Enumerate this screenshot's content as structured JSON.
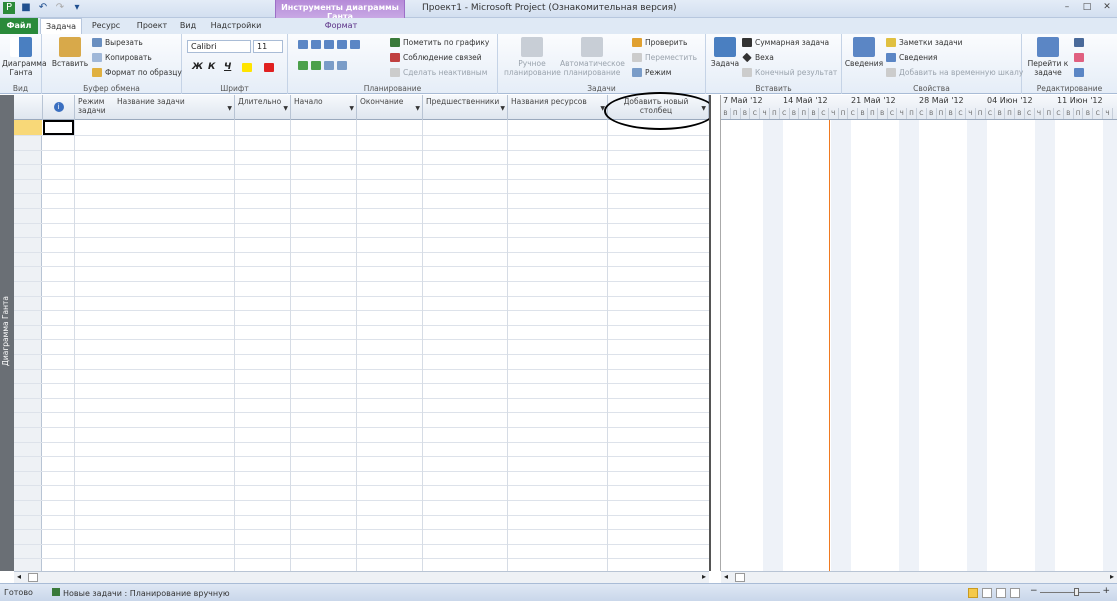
{
  "title": {
    "window": "Проект1 - Microsoft Project (Ознакомительная версия)",
    "context_group": "Инструменты диаграммы Ганта"
  },
  "tabs": [
    "Файл",
    "Задача",
    "Ресурс",
    "Проект",
    "Вид",
    "Надстройки",
    "Формат"
  ],
  "ribbon": {
    "view": {
      "gantt": "Диаграмма Ганта",
      "label": "Вид"
    },
    "clipboard": {
      "paste": "Вставить",
      "cut": "Вырезать",
      "copy": "Копировать",
      "format": "Формат по образцу",
      "label": "Буфер обмена"
    },
    "font": {
      "name": "Calibri",
      "size": "11",
      "bold": "Ж",
      "italic": "К",
      "underline": "Ч",
      "label": "Шрифт"
    },
    "schedule": {
      "mark": "Пометить по графику",
      "respect": "Соблюдение связей",
      "inactive": "Сделать неактивным",
      "label": "Планирование"
    },
    "tasks": {
      "manual": "Ручное планирование",
      "auto": "Автоматическое планирование",
      "inspect": "Проверить",
      "move": "Переместить",
      "mode": "Режим",
      "label": "Задачи"
    },
    "insert": {
      "task": "Задача",
      "summary": "Суммарная задача",
      "milestone": "Веха",
      "deliverable": "Конечный результат",
      "label": "Вставить"
    },
    "properties": {
      "info": "Сведения",
      "notes": "Заметки задачи",
      "details": "Сведения",
      "timeline": "Добавить на временную шкалу",
      "label": "Свойства"
    },
    "editing": {
      "scroll": "Перейти к задаче",
      "label": "Редактирование"
    }
  },
  "sidebar_label": "Диаграмма Ганта",
  "columns": [
    "Режим задачи",
    "Название задачи",
    "Длительно",
    "Начало",
    "Окончание",
    "Предшественники",
    "Названия ресурсов",
    "Добавить новый столбец"
  ],
  "timeline": {
    "weeks": [
      "7 Май '12",
      "14 Май '12",
      "21 Май '12",
      "28 Май '12",
      "04 Июн '12",
      "11 Июн '12"
    ],
    "days": [
      "В",
      "П",
      "В",
      "С",
      "Ч",
      "П",
      "С"
    ]
  },
  "status": {
    "ready": "Готово",
    "newtasks": "Новые задачи : Планирование вручную"
  }
}
